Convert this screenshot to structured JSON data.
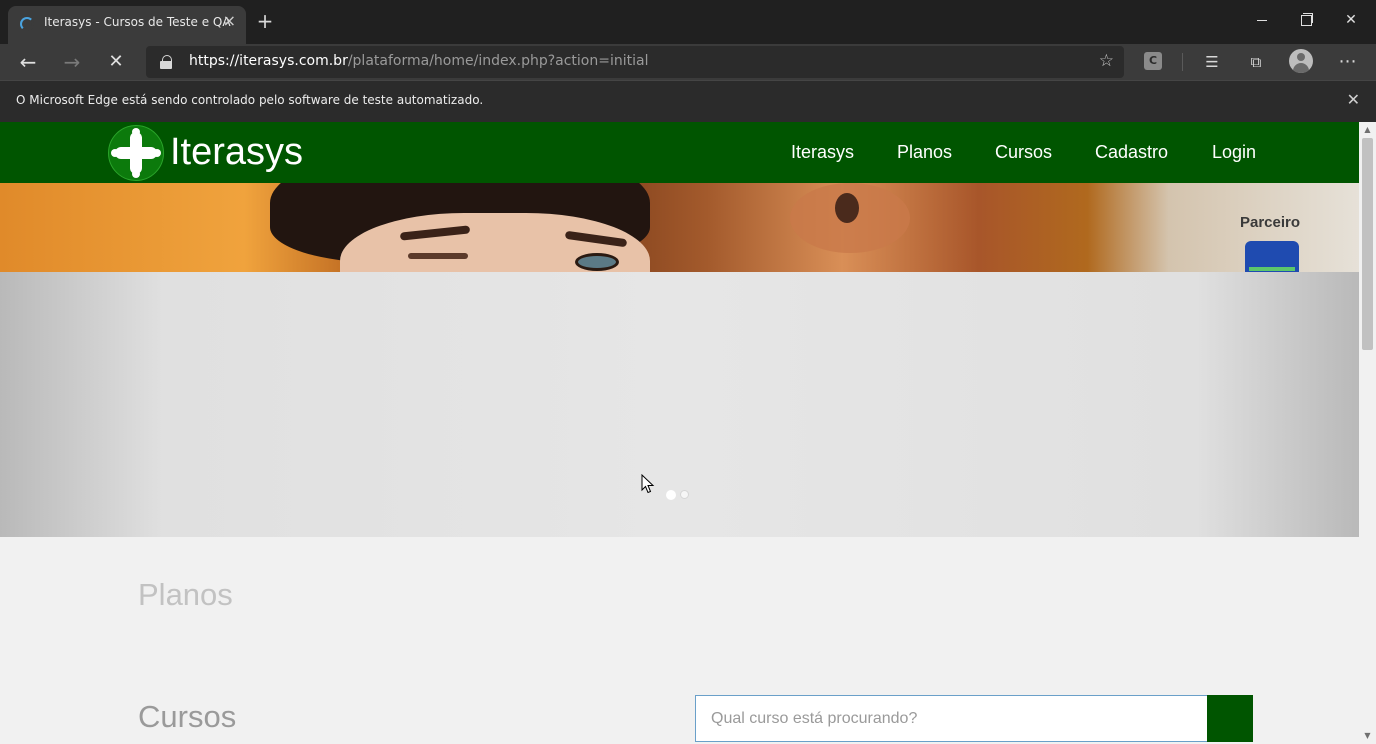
{
  "browser": {
    "tab_title": "Iterasys - Cursos de Teste e QA",
    "url_host": "https://iterasys.com.br",
    "url_path": "/plataforma/home/index.php?action=initial",
    "extension_letter": "C",
    "infobar_text": "O Microsoft Edge está sendo controlado pelo software de teste automatizado."
  },
  "site": {
    "logo_text": "Iterasys",
    "menu": [
      "Iterasys",
      "Planos",
      "Cursos",
      "Cadastro",
      "Login"
    ],
    "partner_label": "Parceiro",
    "carousel_dots": 2,
    "active_slide": 1,
    "sections": {
      "planos": "Planos",
      "cursos": "Cursos"
    },
    "search_placeholder": "Qual curso está procurando?"
  },
  "colors": {
    "brand_green": "#005500",
    "chrome_dark": "#202020",
    "chrome_toolbar": "#3b3b3b"
  }
}
